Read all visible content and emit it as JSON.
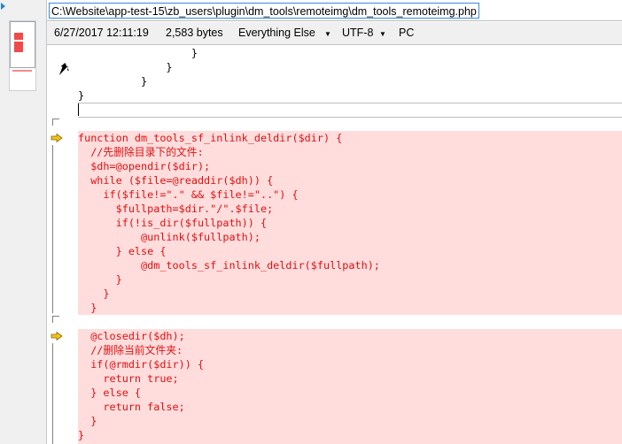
{
  "file": {
    "path": "C:\\Website\\app-test-15\\zb_users\\plugin\\dm_tools\\remoteimg\\dm_tools_remoteimg.php"
  },
  "info": {
    "datetime": "6/27/2017 12:11:19",
    "size": "2,583 bytes",
    "filter": "Everything Else",
    "encoding": "UTF-8",
    "line_endings": "PC"
  },
  "code_top": [
    "                  }",
    "              }",
    "          }",
    "}"
  ],
  "block1": [
    "function dm_tools_sf_inlink_deldir($dir) {",
    "  //先删除目录下的文件:",
    "  $dh=@opendir($dir);",
    "  while ($file=@readdir($dh)) {",
    "    if($file!=\".\" && $file!=\"..\") {",
    "      $fullpath=$dir.\"/\".$file;",
    "      if(!is_dir($fullpath)) {",
    "          @unlink($fullpath);",
    "      } else {",
    "          @dm_tools_sf_inlink_deldir($fullpath);",
    "      }",
    "    }",
    "  }"
  ],
  "block2": [
    "  @closedir($dh);",
    "  //删除当前文件夹:",
    "  if(@rmdir($dir)) {",
    "    return true;",
    "  } else {",
    "    return false;",
    "  }",
    "}"
  ],
  "colors": {
    "diff_background": "#ffdddd",
    "diff_text": "#e01010",
    "change_arrow": "#f0c020"
  }
}
